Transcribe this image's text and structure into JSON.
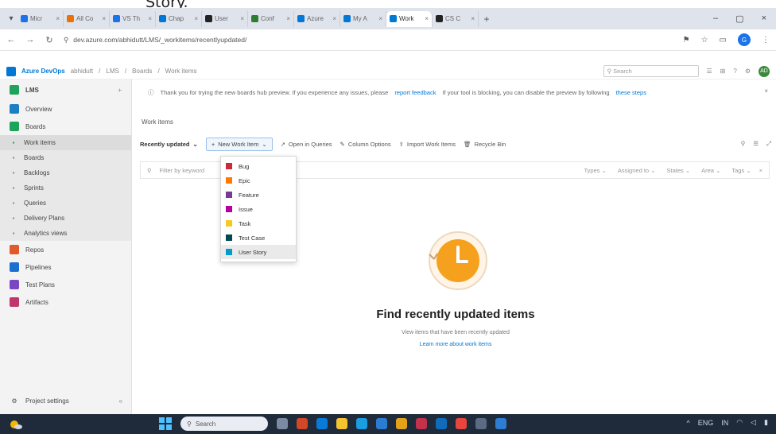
{
  "caption": "Story.",
  "browser": {
    "tabs": [
      {
        "label": "Micr",
        "color": "#1a73e8"
      },
      {
        "label": "All Co",
        "color": "#e8710a"
      },
      {
        "label": "VS Th",
        "color": "#1a73e8"
      },
      {
        "label": "Chap",
        "color": "#0078d4"
      },
      {
        "label": "User",
        "color": "#222222"
      },
      {
        "label": "Conf",
        "color": "#2e7d32"
      },
      {
        "label": "Azure",
        "color": "#0078d4"
      },
      {
        "label": "My A",
        "color": "#0078d4"
      },
      {
        "label": "Work",
        "color": "#0078d4",
        "active": true
      },
      {
        "label": "CS C",
        "color": "#222222"
      }
    ],
    "new_tab": "+",
    "url": "dev.azure.com/abhidutt/LMS/_workitems/recentlyupdated/",
    "window_controls": [
      "–",
      "▢",
      "×"
    ],
    "profile_initial": "G"
  },
  "ado": {
    "brand": "Azure DevOps",
    "breadcrumb": [
      "abhidutt",
      "LMS",
      "Boards",
      "Work items"
    ],
    "search_placeholder": "Search",
    "avatar_initials": "AD"
  },
  "sidebar": {
    "project": "LMS",
    "items": [
      {
        "label": "Overview",
        "icon_color": "#1b7fc4"
      },
      {
        "label": "Boards",
        "icon_color": "#1ea35a"
      },
      {
        "label": "Work items",
        "icon_color": "#1ea35a",
        "selected": true,
        "sub": true
      },
      {
        "label": "Boards",
        "icon_color": "#888888",
        "sub": true
      },
      {
        "label": "Backlogs",
        "icon_color": "#888888",
        "sub": true
      },
      {
        "label": "Sprints",
        "icon_color": "#888888",
        "sub": true
      },
      {
        "label": "Queries",
        "icon_color": "#888888",
        "sub": true
      },
      {
        "label": "Delivery Plans",
        "icon_color": "#888888",
        "sub": true
      },
      {
        "label": "Analytics views",
        "icon_color": "#888888",
        "sub": true
      },
      {
        "label": "Repos",
        "icon_color": "#e05a2a"
      },
      {
        "label": "Pipelines",
        "icon_color": "#1b6fd1"
      },
      {
        "label": "Test Plans",
        "icon_color": "#7b46c4"
      },
      {
        "label": "Artifacts",
        "icon_color": "#c0356b"
      }
    ],
    "project_settings": "Project settings"
  },
  "banner": {
    "text": "Thank you for trying the new boards hub preview. If you experience any issues, please",
    "link": "report feedback",
    "text2": "If your tool is blocking, you can disable the preview by following",
    "link2": "these steps"
  },
  "page": {
    "title": "Work items",
    "view_selector": "Recently updated",
    "new_work_item": "New Work Item",
    "toolbar_items": [
      "Open in Queries",
      "Column Options",
      "Import Work Items",
      "Recycle Bin"
    ],
    "filter_placeholder": "Filter by keyword",
    "filter_fields": [
      "Types",
      "Assigned to",
      "States",
      "Area",
      "Tags"
    ]
  },
  "dropdown": {
    "items": [
      {
        "label": "Bug",
        "color": "#cc293d"
      },
      {
        "label": "Epic",
        "color": "#ff7b00"
      },
      {
        "label": "Feature",
        "color": "#773b93"
      },
      {
        "label": "Issue",
        "color": "#b4009e"
      },
      {
        "label": "Task",
        "color": "#f2cb1d"
      },
      {
        "label": "Test Case",
        "color": "#004b50"
      },
      {
        "label": "User Story",
        "color": "#009ccc",
        "hover": true
      }
    ]
  },
  "empty_state": {
    "title": "Find recently updated items",
    "subtitle": "View items that have been recently updated",
    "link": "Learn more about work items"
  },
  "taskbar": {
    "search_label": "Search",
    "tray_lang": "ENG",
    "tray_region": "IN"
  }
}
